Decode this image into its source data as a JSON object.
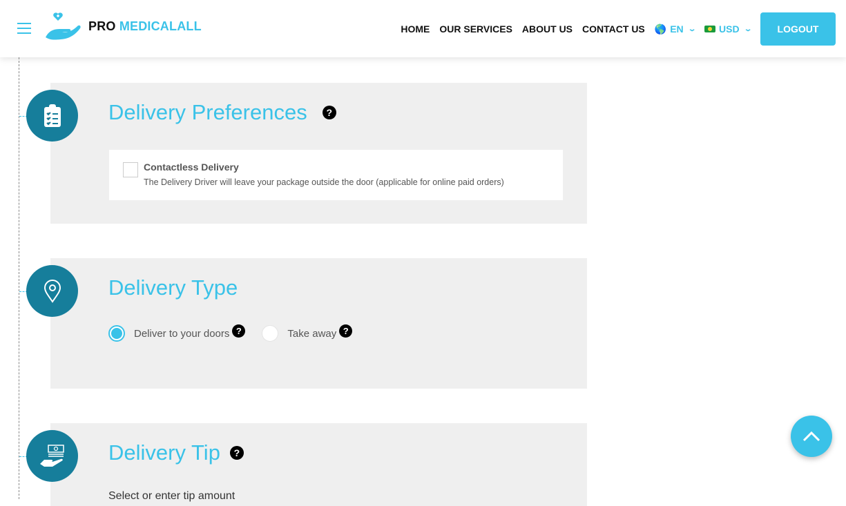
{
  "header": {
    "brand_a": "PRO",
    "brand_b": "MEDICALALL",
    "nav": [
      "HOME",
      "OUR SERVICES",
      "ABOUT US",
      "CONTACT US"
    ],
    "language": "EN",
    "currency": "USD",
    "logout": "LOGOUT"
  },
  "preferences": {
    "title": "Delivery Preferences",
    "option_title": "Contactless Delivery",
    "option_desc": "The Delivery Driver will leave your package outside the door (applicable for online paid orders)",
    "checked": false
  },
  "type": {
    "title": "Delivery Type",
    "options": [
      {
        "label": "Deliver to your doors",
        "selected": true
      },
      {
        "label": "Take away",
        "selected": false
      }
    ]
  },
  "tip": {
    "title": "Delivery Tip",
    "subtitle": "Select or enter tip amount"
  },
  "help": "?",
  "colors": {
    "brand": "#3ac2e8",
    "icon_circle": "#167e9b",
    "panel": "#efefef"
  }
}
